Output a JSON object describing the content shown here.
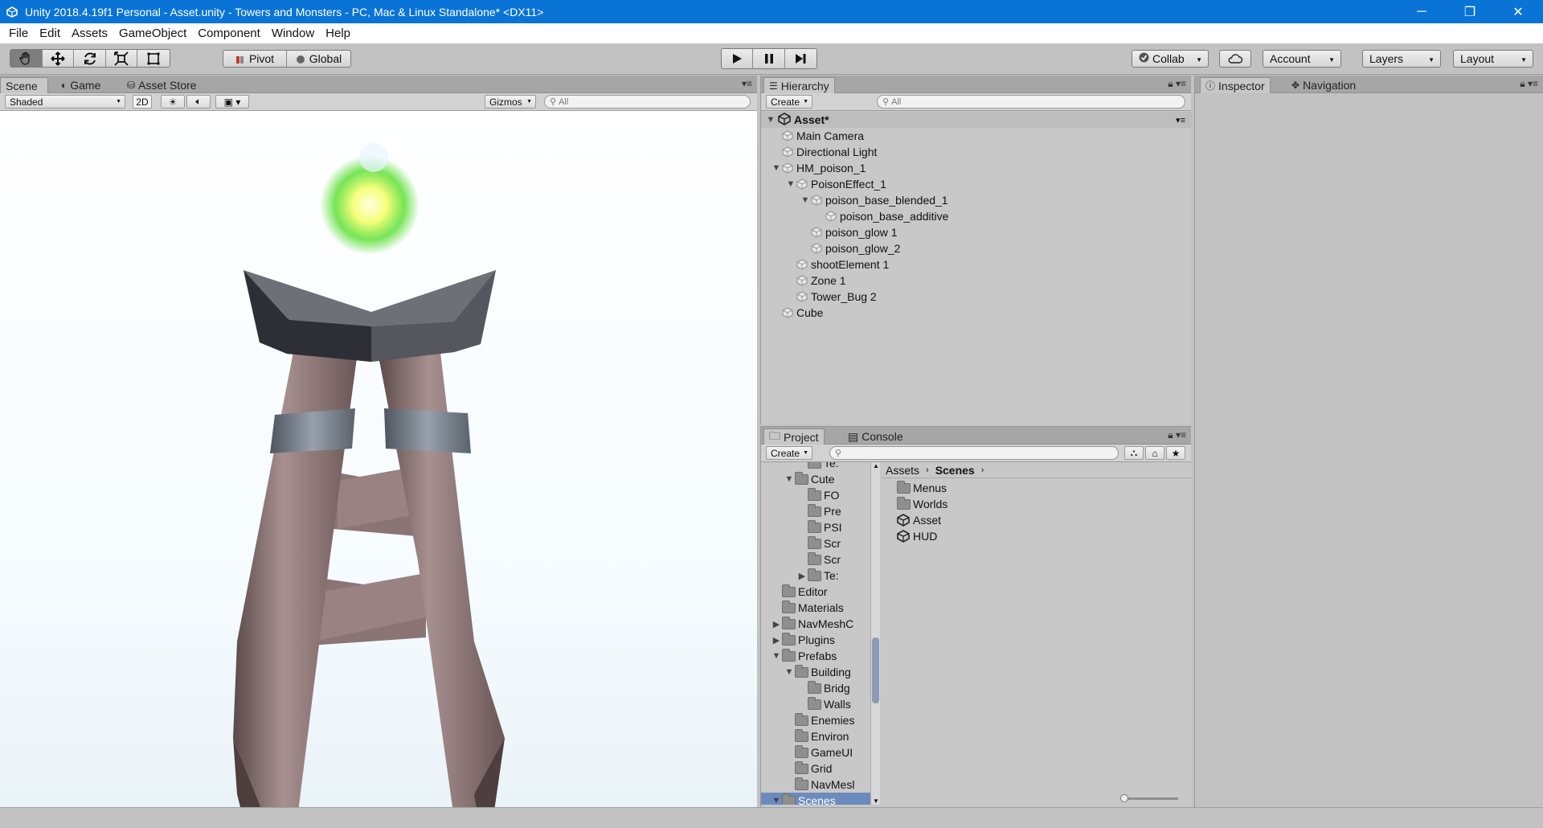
{
  "titlebar": {
    "title": "Unity 2018.4.19f1 Personal - Asset.unity - Towers and Monsters - PC, Mac & Linux Standalone* <DX11>",
    "minimize": "─",
    "restore": "❐",
    "close": "✕"
  },
  "menu": [
    "File",
    "Edit",
    "Assets",
    "GameObject",
    "Component",
    "Window",
    "Help"
  ],
  "toolbar": {
    "pivot": "Pivot",
    "global": "Global",
    "collab": "Collab",
    "account": "Account",
    "layers": "Layers",
    "layout": "Layout"
  },
  "scene": {
    "tabs": [
      "Scene",
      "Game",
      "Asset Store"
    ],
    "shading": "Shaded",
    "mode_2d": "2D",
    "gizmos": "Gizmos",
    "search_placeholder": "All"
  },
  "hierarchy": {
    "tab": "Hierarchy",
    "create": "Create",
    "search_placeholder": "All",
    "scene_name": "Asset*",
    "items": [
      {
        "label": "Main Camera",
        "depth": 0,
        "fold": ""
      },
      {
        "label": "Directional Light",
        "depth": 0,
        "fold": ""
      },
      {
        "label": "HM_poison_1",
        "depth": 0,
        "fold": "▼"
      },
      {
        "label": "PoisonEffect_1",
        "depth": 1,
        "fold": "▼"
      },
      {
        "label": "poison_base_blended_1",
        "depth": 2,
        "fold": "▼"
      },
      {
        "label": "poison_base_additive",
        "depth": 3,
        "fold": ""
      },
      {
        "label": "poison_glow 1",
        "depth": 2,
        "fold": ""
      },
      {
        "label": "poison_glow_2",
        "depth": 2,
        "fold": ""
      },
      {
        "label": "shootElement 1",
        "depth": 1,
        "fold": ""
      },
      {
        "label": "Zone 1",
        "depth": 1,
        "fold": ""
      },
      {
        "label": "Tower_Bug 2",
        "depth": 1,
        "fold": ""
      },
      {
        "label": "Cube",
        "depth": 0,
        "fold": ""
      }
    ]
  },
  "inspector": {
    "tabs": [
      "Inspector",
      "Navigation"
    ]
  },
  "project": {
    "tabs": [
      "Project",
      "Console"
    ],
    "create": "Create",
    "breadcrumb": [
      "Assets",
      "Scenes"
    ],
    "tree": [
      {
        "label": "Te:",
        "depth": 3,
        "fold": ""
      },
      {
        "label": "Cute",
        "depth": 2,
        "fold": "▼"
      },
      {
        "label": "FO",
        "depth": 3,
        "fold": ""
      },
      {
        "label": "Pre",
        "depth": 3,
        "fold": ""
      },
      {
        "label": "PSI",
        "depth": 3,
        "fold": ""
      },
      {
        "label": "Scr",
        "depth": 3,
        "fold": ""
      },
      {
        "label": "Scr",
        "depth": 3,
        "fold": ""
      },
      {
        "label": "Te:",
        "depth": 3,
        "fold": "▶"
      },
      {
        "label": "Editor",
        "depth": 1,
        "fold": ""
      },
      {
        "label": "Materials",
        "depth": 1,
        "fold": ""
      },
      {
        "label": "NavMeshC",
        "depth": 1,
        "fold": "▶"
      },
      {
        "label": "Plugins",
        "depth": 1,
        "fold": "▶"
      },
      {
        "label": "Prefabs",
        "depth": 1,
        "fold": "▼"
      },
      {
        "label": "Building",
        "depth": 2,
        "fold": "▼"
      },
      {
        "label": "Bridg",
        "depth": 3,
        "fold": ""
      },
      {
        "label": "Walls",
        "depth": 3,
        "fold": ""
      },
      {
        "label": "Enemies",
        "depth": 2,
        "fold": ""
      },
      {
        "label": "Environ",
        "depth": 2,
        "fold": ""
      },
      {
        "label": "GameUI",
        "depth": 2,
        "fold": ""
      },
      {
        "label": "Grid",
        "depth": 2,
        "fold": ""
      },
      {
        "label": "NavMesl",
        "depth": 2,
        "fold": ""
      },
      {
        "label": "Scenes",
        "depth": 1,
        "fold": "▼"
      }
    ],
    "assets": [
      {
        "label": "Menus",
        "kind": "folder"
      },
      {
        "label": "Worlds",
        "kind": "folder"
      },
      {
        "label": "Asset",
        "kind": "scene"
      },
      {
        "label": "HUD",
        "kind": "scene"
      }
    ]
  },
  "colors": {
    "titlebar": "#0a74d6",
    "panel": "#c2c2c2",
    "selection": "#6b8bbf"
  }
}
